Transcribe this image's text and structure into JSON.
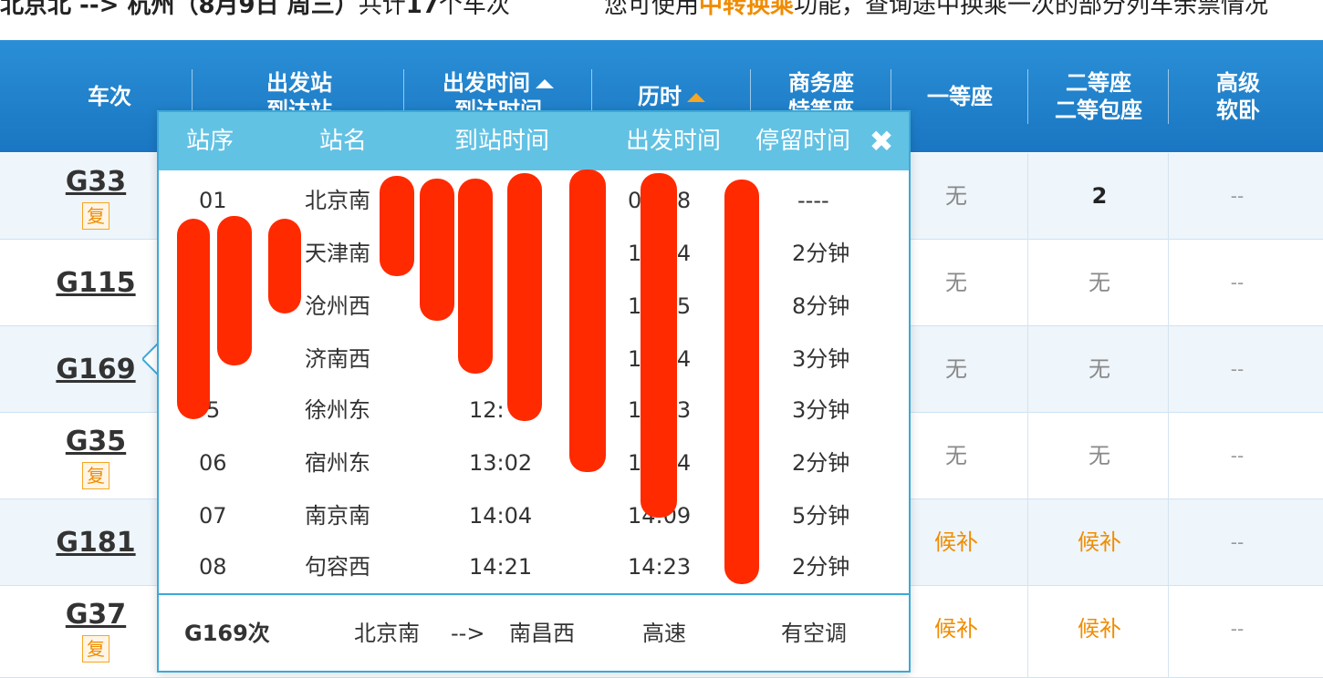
{
  "summary": {
    "route_text": "北京北 --> 杭州（8月9日  周三）",
    "count_prefix": "共计",
    "count": "17",
    "count_suffix": "个车次",
    "notice_prefix": "您可使用",
    "notice_link": "中转换乘",
    "notice_suffix": "功能，查询途中换乘一次的部分列车余票情况"
  },
  "headers": {
    "train": "车次",
    "station_1": "出发站",
    "station_2": "到达站",
    "time_1": "出发时间",
    "time_2": "到达时间",
    "duration": "历时",
    "business_1": "商务座",
    "business_2": "特等座",
    "first": "一等座",
    "second_1": "二等座",
    "second_2": "二等包座",
    "soft_1": "高级",
    "soft_2": "软卧"
  },
  "rows": [
    {
      "train": "G33",
      "fu": "复",
      "first": "无",
      "second": "2",
      "soft": "--"
    },
    {
      "train": "G115",
      "fu": "",
      "first": "无",
      "second": "无",
      "soft": "--"
    },
    {
      "train": "G169",
      "fu": "",
      "first": "无",
      "second": "无",
      "soft": "--"
    },
    {
      "train": "G35",
      "fu": "复",
      "first": "无",
      "second": "无",
      "soft": "--"
    },
    {
      "train": "G181",
      "fu": "",
      "first": "候补",
      "second": "候补",
      "soft": "--"
    },
    {
      "train": "G37",
      "fu": "复",
      "first": "候补",
      "second": "候补",
      "soft": "--"
    }
  ],
  "popup": {
    "headers": {
      "seq": "站序",
      "name": "站名",
      "arrive": "到站时间",
      "depart": "出发时间",
      "stop": "停留时间"
    },
    "close_glyph": "✖",
    "stops": [
      {
        "seq": "01",
        "name": "北京南",
        "arrive": "",
        "depart": "09:08",
        "stop": "----"
      },
      {
        "seq": "",
        "name": "天津南",
        "arrive": "",
        "depart": "10:04",
        "stop": "2分钟"
      },
      {
        "seq": "",
        "name": "沧州西",
        "arrive": "",
        "depart": "10:35",
        "stop": "8分钟"
      },
      {
        "seq": "",
        "name": "济南西",
        "arrive": "",
        "depart": "11:34",
        "stop": "3分钟"
      },
      {
        "seq": "5",
        "name": "徐州东",
        "arrive": "12:",
        "depart": "12:43",
        "stop": "3分钟"
      },
      {
        "seq": "06",
        "name": "宿州东",
        "arrive": "13:02",
        "depart": "13:04",
        "stop": "2分钟"
      },
      {
        "seq": "07",
        "name": "南京南",
        "arrive": "14:04",
        "depart": "14:09",
        "stop": "5分钟"
      },
      {
        "seq": "08",
        "name": "句容西",
        "arrive": "14:21",
        "depart": "14:23",
        "stop": "2分钟"
      }
    ],
    "footer": {
      "train": "G169次",
      "from": "北京南",
      "arrow": "-->",
      "to": "南昌西",
      "type": "高速",
      "ac": "有空调"
    }
  }
}
